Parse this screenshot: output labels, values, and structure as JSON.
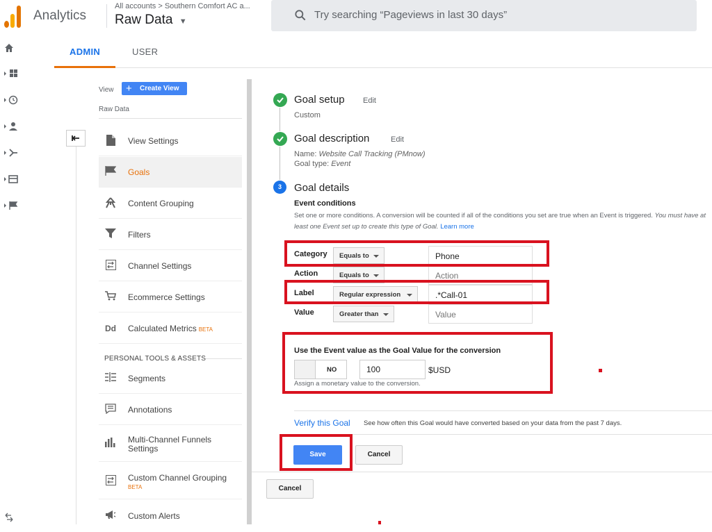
{
  "header": {
    "app_name": "Analytics",
    "breadcrumb": "All accounts > Southern Comfort AC a...",
    "view_name": "Raw Data",
    "search_placeholder": "Try searching “Pageviews in last 30 days”"
  },
  "tabs": [
    {
      "label": "ADMIN",
      "active": true
    },
    {
      "label": "USER",
      "active": false
    }
  ],
  "left_nav": [
    "home-icon",
    "dashboard-icon",
    "clock-icon",
    "person-icon",
    "acquisition-icon",
    "behavior-icon",
    "flag-icon"
  ],
  "view_column": {
    "label": "View",
    "create_button": "Create View",
    "view_name": "Raw Data",
    "items": [
      {
        "label": "View Settings",
        "icon": "document-icon"
      },
      {
        "label": "Goals",
        "icon": "flag-icon",
        "active": true
      },
      {
        "label": "Content Grouping",
        "icon": "content-grouping-icon"
      },
      {
        "label": "Filters",
        "icon": "filter-icon"
      },
      {
        "label": "Channel Settings",
        "icon": "channel-icon"
      },
      {
        "label": "Ecommerce Settings",
        "icon": "cart-icon"
      },
      {
        "label": "Calculated Metrics",
        "icon": "dd-icon",
        "badge": "BETA"
      }
    ],
    "section_header": "PERSONAL TOOLS & ASSETS",
    "personal_items": [
      {
        "label": "Segments",
        "icon": "segments-icon"
      },
      {
        "label": "Annotations",
        "icon": "annotations-icon"
      },
      {
        "label": "Multi-Channel Funnels Settings",
        "icon": "bars-icon"
      },
      {
        "label": "Custom Channel Grouping",
        "icon": "channel-grouping-icon",
        "badge": "BETA"
      },
      {
        "label": "Custom Alerts",
        "icon": "megaphone-icon"
      }
    ]
  },
  "goal": {
    "setup": {
      "title": "Goal setup",
      "edit": "Edit",
      "value": "Custom"
    },
    "description": {
      "title": "Goal description",
      "edit": "Edit",
      "name_label": "Name:",
      "name_value": "Website Call Tracking (PMnow)",
      "type_label": "Goal type:",
      "type_value": "Event"
    },
    "details": {
      "step_number": "3",
      "title": "Goal details",
      "event_conditions_title": "Event conditions",
      "event_conditions_desc": "Set one or more conditions. A conversion will be counted if all of the conditions you set are true when an Event is triggered.",
      "event_conditions_desc_italic": "You must have at least one Event set up to create this type of Goal.",
      "learn_more": "Learn more",
      "conditions": [
        {
          "label": "Category",
          "operator": "Equals to",
          "value": "Phone",
          "placeholder": ""
        },
        {
          "label": "Action",
          "operator": "Equals to",
          "value": "",
          "placeholder": "Action"
        },
        {
          "label": "Label",
          "operator": "Regular expression",
          "value": ".*Call-01",
          "placeholder": ""
        },
        {
          "label": "Value",
          "operator": "Greater than",
          "value": "",
          "placeholder": "Value"
        }
      ],
      "use_event_value_title": "Use the Event value as the Goal Value for the conversion",
      "toggle_label": "NO",
      "value_input": "100",
      "currency": "$USD",
      "assign_hint": "Assign a monetary value to the conversion.",
      "verify_link": "Verify this Goal",
      "verify_text": "See how often this Goal would have converted based on your data from the past 7 days.",
      "save": "Save",
      "cancel": "Cancel"
    },
    "outer_cancel": "Cancel"
  },
  "colors": {
    "accent_blue": "#4285f4",
    "link_blue": "#1a73e8",
    "active_orange": "#e8710a",
    "success_green": "#34a853",
    "highlight_red": "#d9121f"
  }
}
